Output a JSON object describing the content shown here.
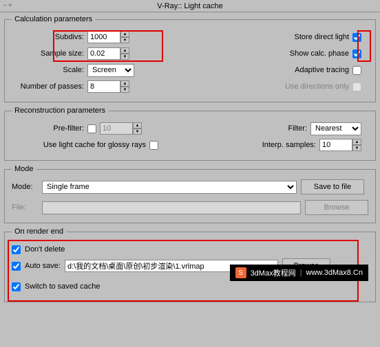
{
  "title": "V-Ray:: Light cache",
  "calc": {
    "legend": "Calculation parameters",
    "subdivs_label": "Subdivs:",
    "subdivs_value": "1000",
    "sample_size_label": "Sample size:",
    "sample_size_value": "0.02",
    "scale_label": "Scale:",
    "scale_value": "Screen",
    "passes_label": "Number of passes:",
    "passes_value": "8",
    "store_direct_label": "Store direct light",
    "show_calc_label": "Show calc. phase",
    "adaptive_label": "Adaptive tracing",
    "directions_label": "Use directions only"
  },
  "recon": {
    "legend": "Reconstruction parameters",
    "prefilter_label": "Pre-filter:",
    "prefilter_value": "10",
    "glossy_label": "Use light cache for glossy rays",
    "filter_label": "Filter:",
    "filter_value": "Nearest",
    "interp_label": "Interp. samples:",
    "interp_value": "10"
  },
  "mode": {
    "legend": "Mode",
    "mode_label": "Mode:",
    "mode_value": "Single frame",
    "save_btn": "Save to file",
    "file_label": "File:",
    "file_value": "",
    "browse_btn": "Browse"
  },
  "onend": {
    "legend": "On render end",
    "dont_delete_label": "Don't delete",
    "auto_save_label": "Auto save:",
    "auto_save_value": "d:\\我的文档\\桌面\\原创\\初步渲染\\1.vrlmap",
    "browse_btn": "Browse",
    "switch_label": "Switch to saved cache"
  },
  "banner": {
    "text1": "3dMax教程网",
    "text2": "www.3dMax8.Cn"
  }
}
